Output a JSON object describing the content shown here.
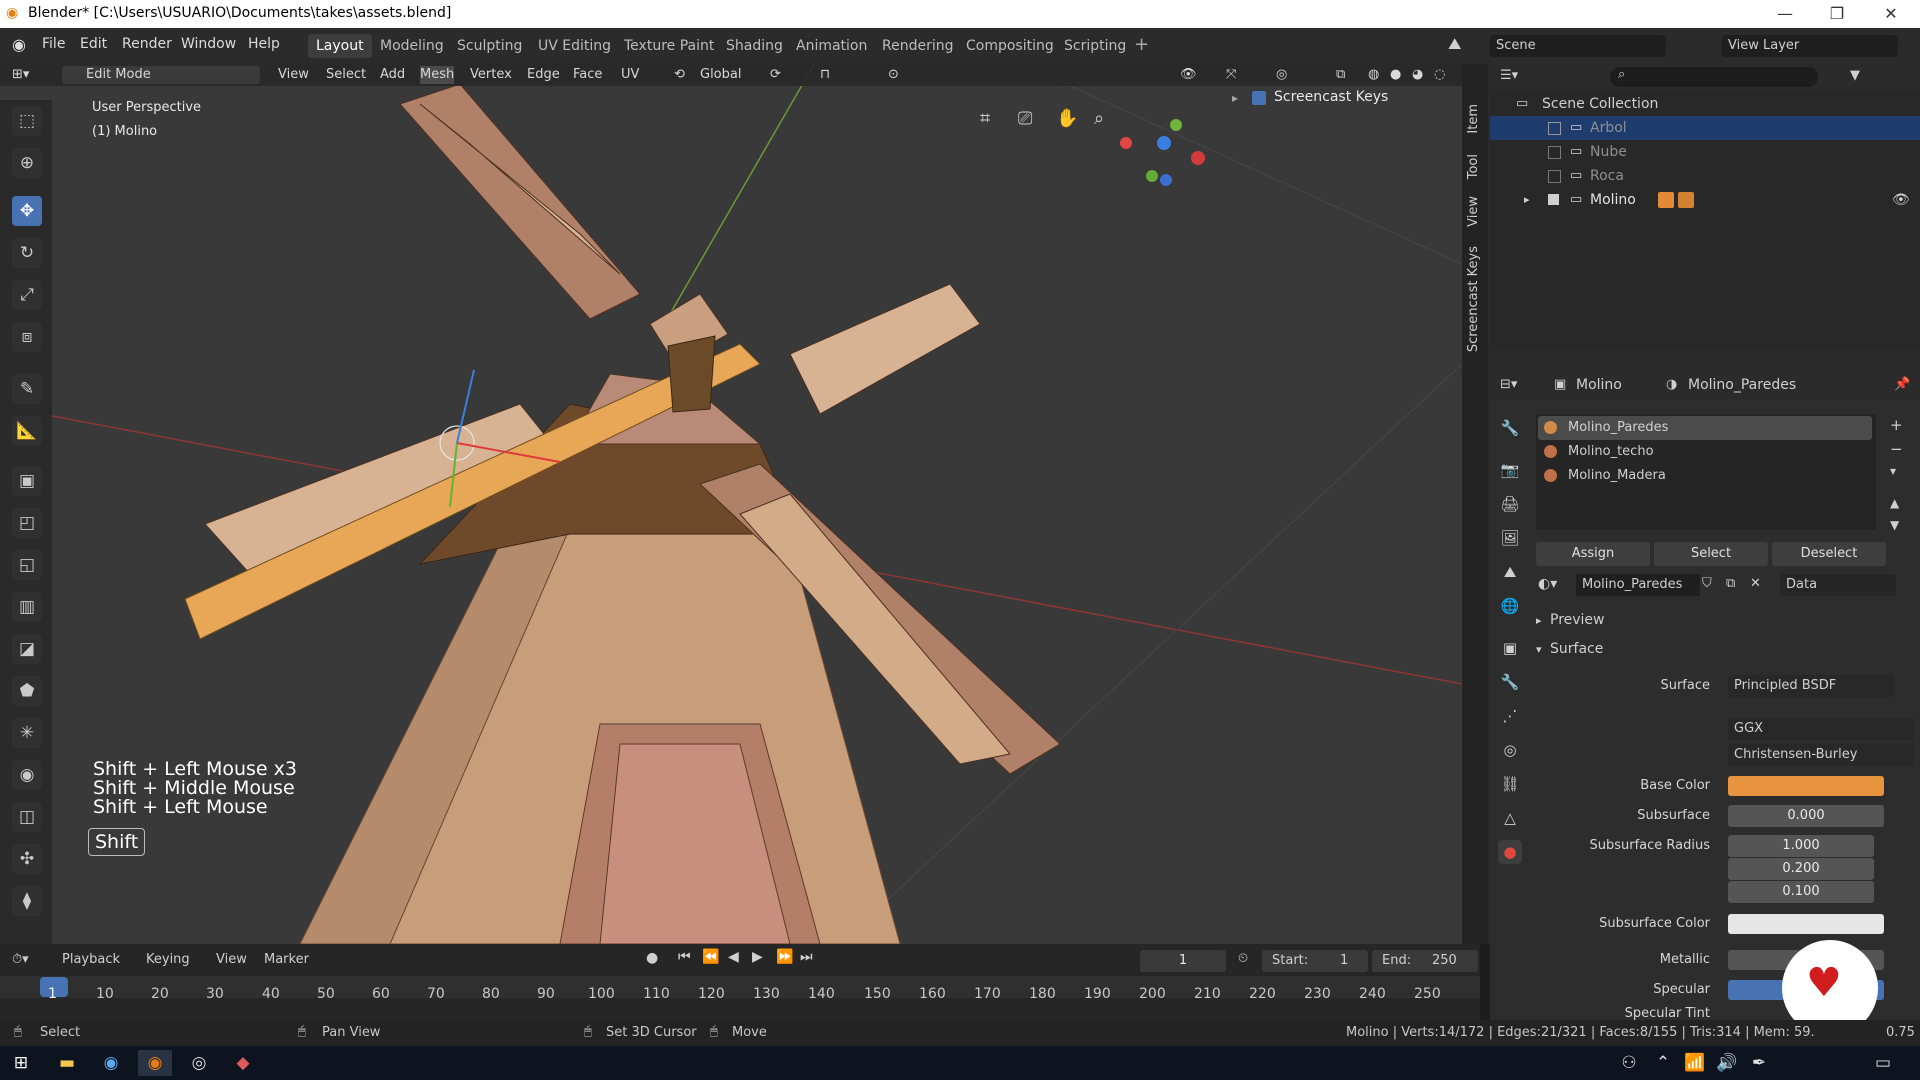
{
  "titlebar": {
    "title": "Blender* [C:\\Users\\USUARIO\\Documents\\takes\\assets.blend]",
    "minimize": "—",
    "maximize": "❐",
    "close": "✕"
  },
  "menubar": [
    "File",
    "Edit",
    "Render",
    "Window",
    "Help"
  ],
  "workspaces": [
    "Layout",
    "Modeling",
    "Sculpting",
    "UV Editing",
    "Texture Paint",
    "Shading",
    "Animation",
    "Rendering",
    "Compositing",
    "Scripting"
  ],
  "active_workspace": "Layout",
  "scene": {
    "label": "Scene",
    "view_layer": "View Layer"
  },
  "viewport_header": {
    "mode": "Edit Mode",
    "menus": [
      "View",
      "Select",
      "Add",
      "Mesh",
      "Vertex",
      "Edge",
      "Face",
      "UV"
    ],
    "orientation": "Global"
  },
  "viewport": {
    "perspective": "User Perspective",
    "object": "(1) Molino",
    "screencast_label": "Screencast Keys",
    "tabs": [
      "Item",
      "Tool",
      "View",
      "Screencast Keys"
    ],
    "keys": [
      "Shift + Left Mouse x3",
      "Shift + Middle Mouse",
      "Shift + Left Mouse"
    ],
    "key_badge": "Shift"
  },
  "outliner": {
    "root": "Scene Collection",
    "items": [
      {
        "name": "Arbol",
        "selected": true
      },
      {
        "name": "Nube",
        "selected": false
      },
      {
        "name": "Roca",
        "selected": false
      },
      {
        "name": "Molino",
        "selected": false
      }
    ]
  },
  "properties": {
    "object": "Molino",
    "material": "Molino_Paredes",
    "slots": [
      "Molino_Paredes",
      "Molino_techo",
      "Molino_Madera"
    ],
    "buttons": [
      "Assign",
      "Select",
      "Deselect"
    ],
    "material_field": "Molino_Paredes",
    "link": "Data",
    "preview": "Preview",
    "surface_section": "Surface",
    "surface_label": "Surface",
    "surface_value": "Principled BSDF",
    "distribution": "GGX",
    "subsurface_method": "Christensen-Burley",
    "base_color_label": "Base Color",
    "base_color": "#e8943f",
    "subsurface_label": "Subsurface",
    "subsurface_value": "0.000",
    "ss_radius_label": "Subsurface Radius",
    "ss_radius": [
      "1.000",
      "0.200",
      "0.100"
    ],
    "ss_color_label": "Subsurface Color",
    "metallic_label": "Metallic",
    "specular_label": "Specular",
    "specular_tint_label": "Specular Tint"
  },
  "timeline": {
    "menus": [
      "Playback",
      "Keying",
      "View",
      "Marker"
    ],
    "current_frame": "1",
    "start_label": "Start:",
    "start": "1",
    "end_label": "End:",
    "end": "250",
    "ruler": [
      "1",
      "10",
      "20",
      "30",
      "40",
      "50",
      "60",
      "70",
      "80",
      "90",
      "100",
      "110",
      "120",
      "130",
      "140",
      "150",
      "160",
      "170",
      "180",
      "190",
      "200",
      "210",
      "220",
      "230",
      "240",
      "250"
    ]
  },
  "statusbar": {
    "select": "Select",
    "pan": "Pan View",
    "cursor": "Set 3D Cursor",
    "move": "Move",
    "stats": "Molino | Verts:14/172 | Edges:21/321 | Faces:8/155 | Tris:314 | Mem: 59.",
    "version": "0.75"
  }
}
